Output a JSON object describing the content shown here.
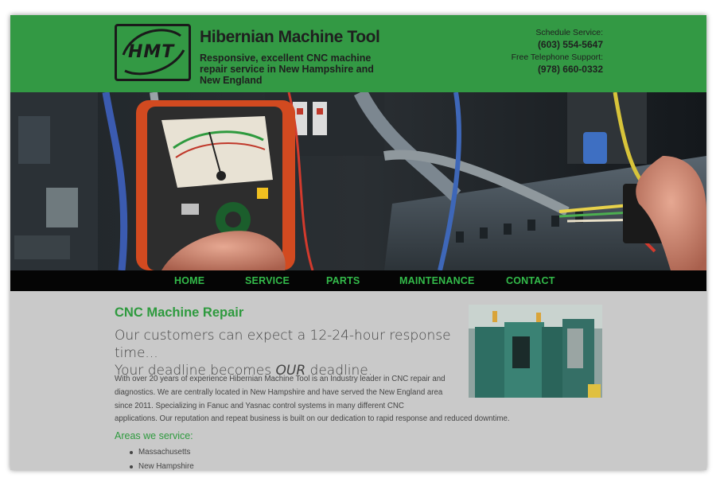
{
  "header": {
    "logo_text": "HMT",
    "company_name": "Hibernian Machine Tool",
    "tagline": "Responsive, excellent CNC machine repair service in New Hampshire and New England",
    "schedule_label": "Schedule Service:",
    "schedule_phone": "(603) 554-5647",
    "support_label": "Free Telephone Support:",
    "support_phone": "(978) 660-0332"
  },
  "nav": {
    "items": [
      "HOME",
      "SERVICE",
      "PARTS",
      "MAINTENANCE",
      "CONTACT"
    ]
  },
  "main": {
    "heading": "CNC Machine Repair",
    "response_line1": "Our customers can expect a 12-24-hour response time...",
    "response_line2_pre": "Your deadline becomes ",
    "response_line2_em": "OUR",
    "response_line2_post": " deadline.",
    "paragraph_lines": [
      "With over 20 years of experience Hibernian Machine Tool is an Industry leader in CNC repair and",
      "diagnostics. We are centrally located in New Hampshire and have served the New England area",
      "since 2011. Specializing in Fanuc and Yasnac control systems in many different CNC",
      "applications. Our reputation and repeat business is built on our dedication to rapid response and reduced downtime."
    ],
    "areas_heading": "Areas we service:",
    "areas": [
      "Massachusetts",
      "New Hampshire"
    ]
  },
  "colors": {
    "brand_green": "#339944",
    "nav_text": "#33bb4a",
    "heading_green": "#2e9a3e",
    "nav_bg": "#050505",
    "content_bg": "#c9c9c9"
  },
  "icons": {
    "logo": "hmt-logo-icon"
  }
}
